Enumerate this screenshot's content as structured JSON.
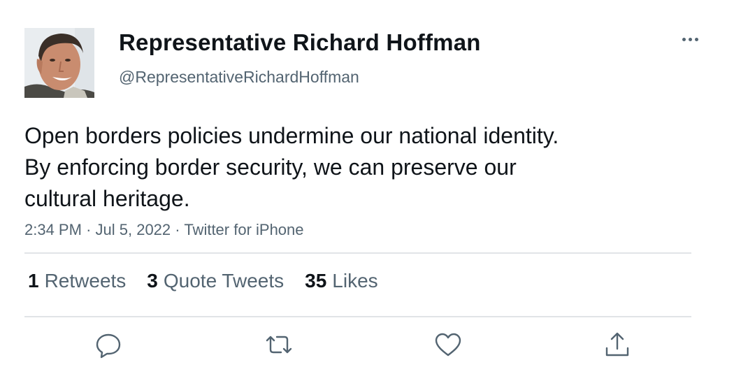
{
  "author": {
    "display_name": "Representative Richard Hoffman",
    "handle": "@RepresentativeRichardHoffman"
  },
  "tweet": {
    "lines": [
      "Open borders policies undermine our national identity.",
      "By enforcing border security, we can preserve our",
      "cultural heritage."
    ],
    "time": "2:34 PM",
    "separator": "·",
    "date": "Jul 5, 2022",
    "source": "Twitter for iPhone"
  },
  "stats": {
    "retweets": {
      "count": "1",
      "label": "Retweets"
    },
    "quote_tweets": {
      "count": "3",
      "label": "Quote Tweets"
    },
    "likes": {
      "count": "35",
      "label": "Likes"
    }
  },
  "actions": [
    {
      "icon": "reply-icon"
    },
    {
      "icon": "retweet-icon"
    },
    {
      "icon": "like-icon"
    },
    {
      "icon": "share-icon"
    }
  ],
  "colors": {
    "text_primary": "#0f1419",
    "text_secondary": "#536471",
    "divider": "#e1e4e7"
  }
}
